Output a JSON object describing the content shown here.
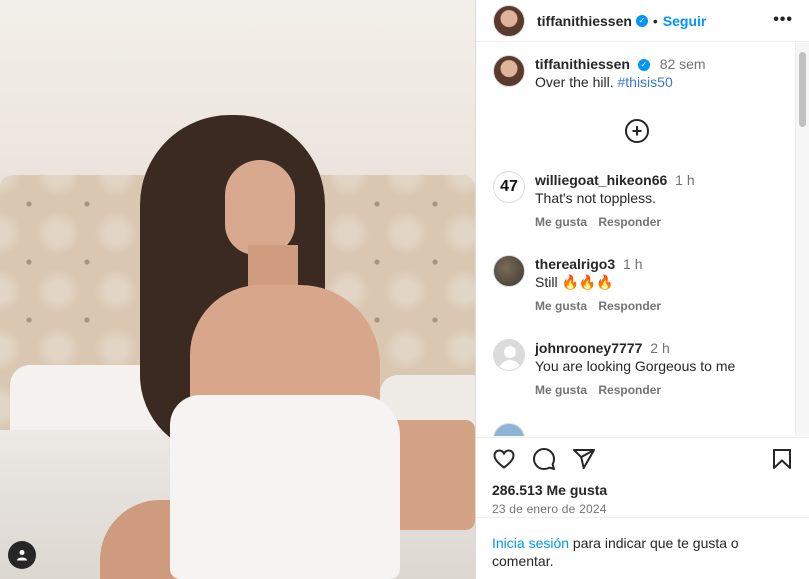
{
  "header": {
    "username": "tiffanithiessen",
    "separator": "•",
    "follow_label": "Seguir",
    "more_label": "•••"
  },
  "caption": {
    "username": "tiffanithiessen",
    "time": "82 sem",
    "text": "Over the hill.",
    "hashtag": "#thisis50"
  },
  "comments": [
    {
      "username": "williegoat_hikeon66",
      "time": "1 h",
      "text": "That's not toppless.",
      "avatar_text": "47",
      "like_label": "Me gusta",
      "reply_label": "Responder"
    },
    {
      "username": "therealrigo3",
      "time": "1 h",
      "text": "Still 🔥🔥🔥",
      "like_label": "Me gusta",
      "reply_label": "Responder"
    },
    {
      "username": "johnrooney7777",
      "time": "2 h",
      "text": "You are looking Gorgeous to me",
      "like_label": "Me gusta",
      "reply_label": "Responder"
    }
  ],
  "footer": {
    "likes": "286.513 Me gusta",
    "date": "23 de enero de 2024",
    "login_link": "Inicia sesión",
    "login_text": " para indicar que te gusta o comentar."
  },
  "icons": {
    "like": "heart-icon",
    "comment": "comment-icon",
    "share": "share-icon",
    "save": "bookmark-icon",
    "load_more": "plus-circle-icon",
    "user_tag": "user-icon",
    "verified": "verified-badge-icon"
  },
  "colors": {
    "accent": "#0095f6",
    "verified": "#0095f6",
    "muted": "#737373",
    "text": "#262626"
  }
}
